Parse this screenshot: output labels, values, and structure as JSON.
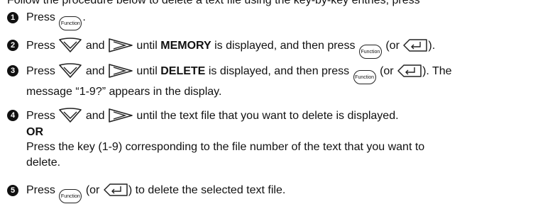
{
  "intro": "Follow the procedure below to delete a text file using the key-by-key entries; press",
  "steps": [
    {
      "number": "1",
      "parts": {
        "press": "Press",
        "key": "Function",
        "end": "."
      }
    },
    {
      "number": "2",
      "parts": {
        "press": "Press",
        "and": "and",
        "until": "until",
        "target": "MEMORY",
        "shown": "is displayed, and then press",
        "key": "Function",
        "or": "(or",
        "close": ")."
      }
    },
    {
      "number": "3",
      "parts": {
        "press": "Press",
        "and": "and",
        "until": "until",
        "target": "DELETE",
        "shown": "is displayed, and then press",
        "key": "Function",
        "or": "(or",
        "close": "). The",
        "line2": "message “1-9?” appears in the display."
      }
    },
    {
      "number": "4",
      "parts": {
        "press": "Press",
        "and": "and",
        "rest": "until the text file that you want to delete is displayed.",
        "or_label": "OR",
        "alt_line1": "Press the key (1-9) corresponding to the file number of the text that you want to",
        "alt_line2": "delete."
      }
    },
    {
      "number": "5",
      "parts": {
        "press": "Press",
        "key": "Function",
        "or": "(or",
        "rest": ") to delete the selected text file."
      }
    }
  ],
  "icons": {
    "cursor_down": "cursor-down-key-icon",
    "cursor_right": "cursor-right-key-icon",
    "enter": "enter-key-icon",
    "function": "function-key-icon"
  }
}
